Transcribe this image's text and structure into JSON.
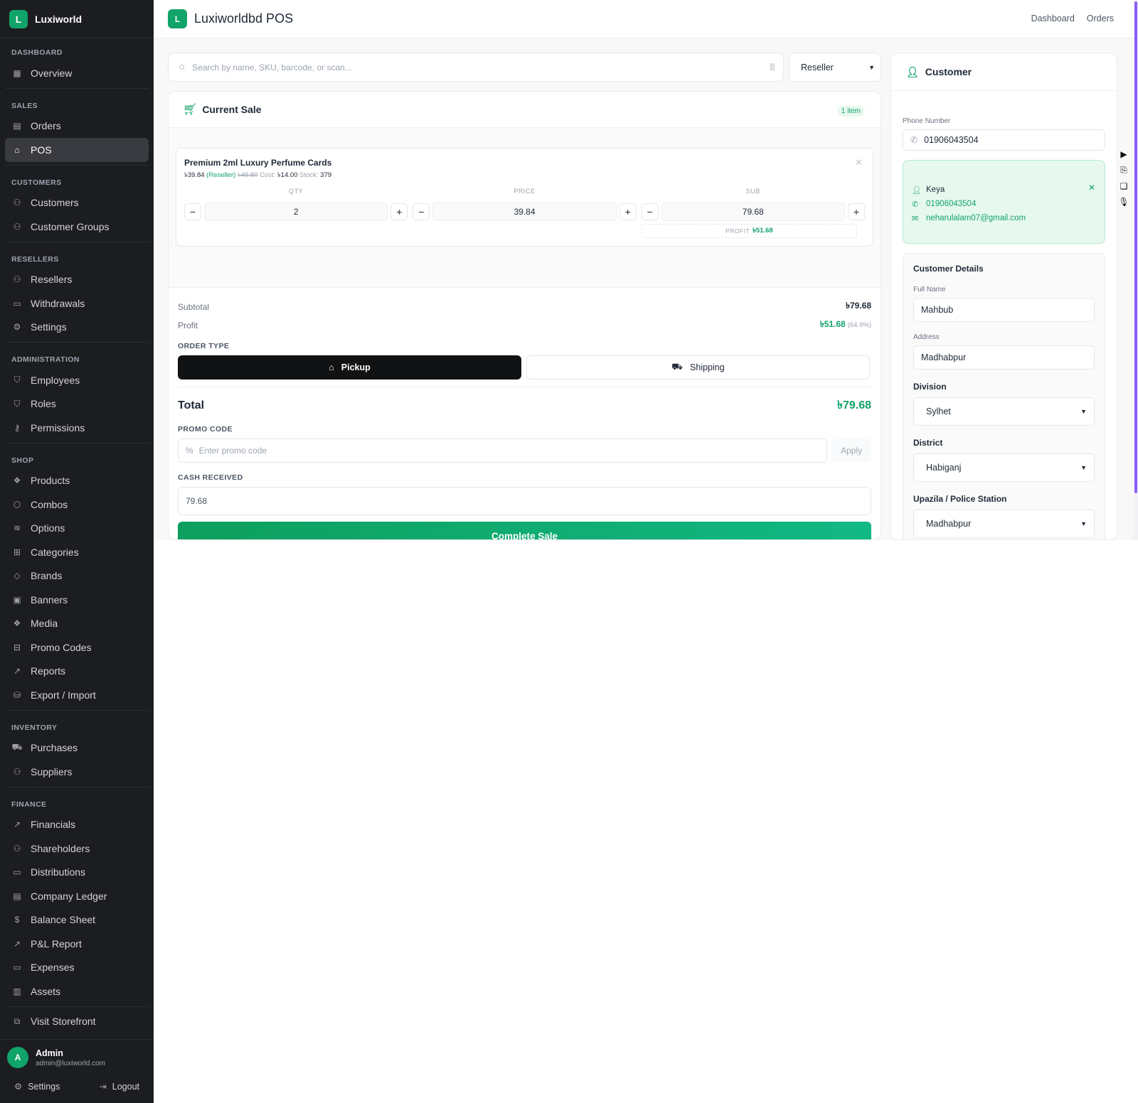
{
  "sidebar": {
    "brand_letter": "L",
    "brand_name": "Luxiworld",
    "sections": [
      {
        "title": "DASHBOARD",
        "items": [
          {
            "label": "Overview",
            "icon": "grid-icon"
          }
        ]
      },
      {
        "title": "SALES",
        "items": [
          {
            "label": "Orders",
            "icon": "receipt-icon"
          },
          {
            "label": "POS",
            "icon": "store-icon",
            "active": true
          }
        ]
      },
      {
        "title": "CUSTOMERS",
        "items": [
          {
            "label": "Customers",
            "icon": "users-icon"
          },
          {
            "label": "Customer Groups",
            "icon": "users-icon"
          }
        ]
      },
      {
        "title": "RESELLERS",
        "items": [
          {
            "label": "Resellers",
            "icon": "users-icon"
          },
          {
            "label": "Withdrawals",
            "icon": "wallet-icon"
          },
          {
            "label": "Settings",
            "icon": "gear-icon"
          }
        ]
      },
      {
        "title": "ADMINISTRATION",
        "items": [
          {
            "label": "Employees",
            "icon": "shield-icon"
          },
          {
            "label": "Roles",
            "icon": "shield-check-icon"
          },
          {
            "label": "Permissions",
            "icon": "key-icon"
          }
        ]
      },
      {
        "title": "SHOP",
        "items": [
          {
            "label": "Products",
            "icon": "boxes-icon"
          },
          {
            "label": "Combos",
            "icon": "package-icon"
          },
          {
            "label": "Options",
            "icon": "layers-icon"
          },
          {
            "label": "Categories",
            "icon": "folder-tree-icon"
          },
          {
            "label": "Brands",
            "icon": "tag-icon"
          },
          {
            "label": "Banners",
            "icon": "image-icon"
          },
          {
            "label": "Media",
            "icon": "boxes-icon"
          },
          {
            "label": "Promo Codes",
            "icon": "ticket-icon"
          },
          {
            "label": "Reports",
            "icon": "trending-up-icon"
          },
          {
            "label": "Export / Import",
            "icon": "database-icon"
          }
        ]
      },
      {
        "title": "INVENTORY",
        "items": [
          {
            "label": "Purchases",
            "icon": "truck-icon"
          },
          {
            "label": "Suppliers",
            "icon": "users-icon"
          }
        ]
      },
      {
        "title": "FINANCE",
        "items": [
          {
            "label": "Financials",
            "icon": "trending-up-icon"
          },
          {
            "label": "Shareholders",
            "icon": "users-icon"
          },
          {
            "label": "Distributions",
            "icon": "card-icon"
          },
          {
            "label": "Company Ledger",
            "icon": "receipt-icon"
          },
          {
            "label": "Balance Sheet",
            "icon": "dollar-icon"
          },
          {
            "label": "P&L Report",
            "icon": "trending-up-icon"
          },
          {
            "label": "Expenses",
            "icon": "wallet-icon"
          },
          {
            "label": "Assets",
            "icon": "building-icon"
          }
        ]
      }
    ],
    "visit_storefront": "Visit Storefront",
    "user": {
      "initial": "A",
      "name": "Admin",
      "email": "admin@luxiworld.com",
      "settings": "Settings",
      "logout": "Logout"
    }
  },
  "header": {
    "logo_letter": "L",
    "title": "Luxiworldbd POS",
    "links": [
      "Dashboard",
      "Orders"
    ]
  },
  "search": {
    "placeholder": "Search by name, SKU, barcode, or scan...",
    "price_mode": "Reseller"
  },
  "sale": {
    "title": "Current Sale",
    "item_count": "1 item",
    "item": {
      "name": "Premium 2ml Luxury Perfume Cards",
      "price": "৳39.84",
      "price_tag": "(Reseller)",
      "old_price": "৳49.80",
      "cost_label": "Cost:",
      "cost": "৳14.00",
      "stock_label": "Stock:",
      "stock": "379",
      "qty_label": "QTY",
      "price_label": "PRICE",
      "sub_label": "SUB",
      "qty": "2",
      "unit_price": "39.84",
      "subtotal": "79.68",
      "profit_label": "PROFIT",
      "profit": "৳51.68"
    },
    "subtotal_label": "Subtotal",
    "subtotal": "৳79.68",
    "profit_label": "Profit",
    "profit": "৳51.68",
    "profit_pct": "(64.9%)",
    "order_type_label": "ORDER TYPE",
    "order_types": {
      "pickup": "Pickup",
      "shipping": "Shipping",
      "selected": "Pickup"
    },
    "total_label": "Total",
    "total": "৳79.68",
    "promo_label": "PROMO CODE",
    "promo_placeholder": "Enter promo code",
    "apply": "Apply",
    "cash_label": "CASH RECEIVED",
    "cash_value": "79.68",
    "complete": "Complete Sale"
  },
  "customer": {
    "title": "Customer",
    "phone_label": "Phone Number",
    "phone_value": "01906043504",
    "selected": {
      "name": "Keya",
      "phone": "01906043504",
      "email": "neharulalam07@gmail.com"
    },
    "details_title": "Customer Details",
    "full_name_label": "Full Name",
    "full_name": "Mahbub",
    "address_label": "Address",
    "address": "Madhabpur",
    "division_label": "Division",
    "division": "Sylhet",
    "district_label": "District",
    "district": "Habiganj",
    "upazila_label": "Upazila / Police Station",
    "upazila": "Madhabpur"
  },
  "colors": {
    "accent": "#10a36a",
    "sidebar_bg": "#1c1d20",
    "scroll_thumb": "#8b5cf6"
  }
}
